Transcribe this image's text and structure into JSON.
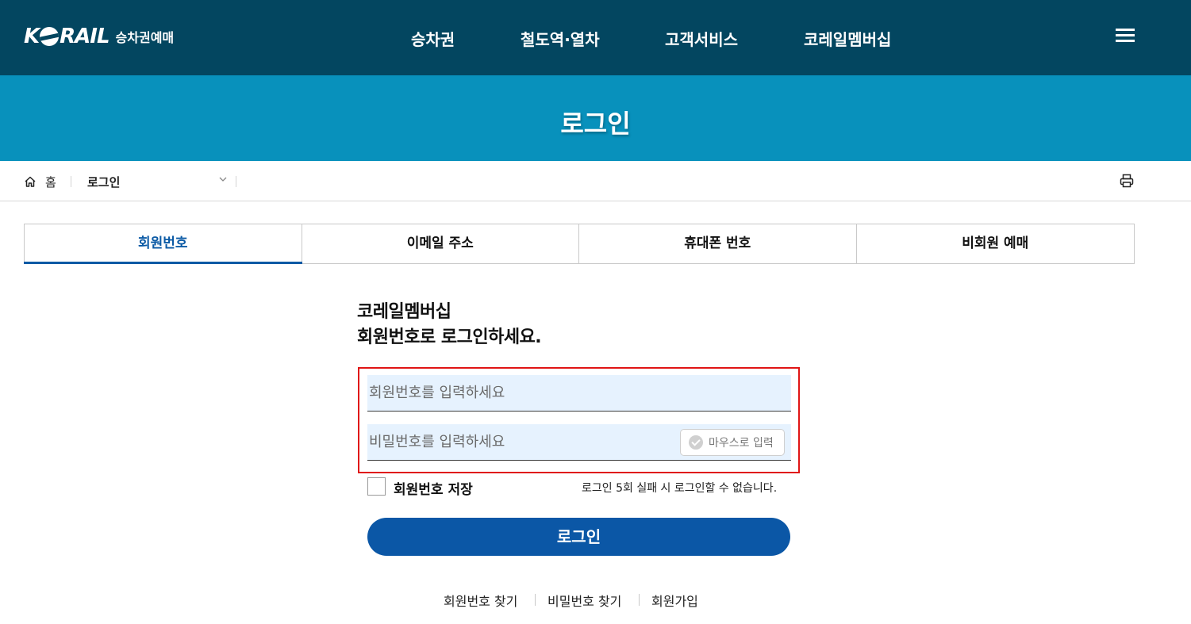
{
  "header": {
    "logo_text": "KORAIL",
    "logo_sub": "승차권예매",
    "nav": [
      "승차권",
      "철도역·열차",
      "고객서비스",
      "코레일멤버십"
    ]
  },
  "banner": {
    "title": "로그인"
  },
  "breadcrumb": {
    "home": "홈",
    "current": "로그인"
  },
  "tabs": [
    {
      "label": "회원번호",
      "active": true
    },
    {
      "label": "이메일 주소",
      "active": false
    },
    {
      "label": "휴대폰 번호",
      "active": false
    },
    {
      "label": "비회원 예매",
      "active": false
    }
  ],
  "login": {
    "heading_line1": "코레일멤버십",
    "heading_line2": "회원번호로 로그인하세요.",
    "member_placeholder": "회원번호를 입력하세요",
    "password_placeholder": "비밀번호를 입력하세요",
    "mouse_input_label": "마우스로 입력",
    "save_label": "회원번호 저장",
    "warning": "로그인 5회 실패 시 로그인할 수 없습니다.",
    "button": "로그인"
  },
  "links": [
    "회원번호 찾기",
    "비밀번호 찾기",
    "회원가입"
  ],
  "colors": {
    "header_bg": "#034660",
    "banner_bg": "#0891bc",
    "accent": "#0b57a6",
    "highlight_border": "#e01515",
    "input_bg": "#e6f2fe"
  }
}
